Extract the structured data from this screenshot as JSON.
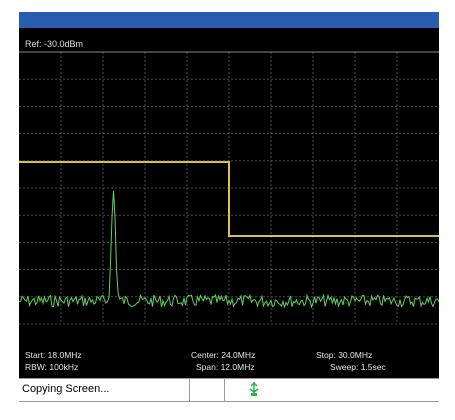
{
  "analyzer": {
    "ref_level": "Ref: -30.0dBm",
    "start": "Start: 18.0MHz",
    "center": "Center: 24.0MHz",
    "stop": "Stop: 30.0MHz",
    "rbw": "RBW: 100kHz",
    "span": "Span: 12.0MHz",
    "sweep": "Sweep: 1.5sec"
  },
  "status": {
    "message": "Copying Screen...",
    "icon": "usb-storage-icon"
  },
  "colors": {
    "title_bar": "#2a5db0",
    "trace": "#62d15c",
    "limit_line": "#d7c24a",
    "grid": "#4d4d4d",
    "background": "#000000"
  },
  "chart_data": {
    "type": "line",
    "x_unit": "MHz",
    "xlim": [
      18.0,
      30.0
    ],
    "grid": true,
    "peak": {
      "x": 20.7
    },
    "limit_line": [
      {
        "x": 18.0,
        "level": "high"
      },
      {
        "x": 24.0,
        "level": "low"
      },
      {
        "x": 30.0,
        "level": "low"
      }
    ]
  }
}
